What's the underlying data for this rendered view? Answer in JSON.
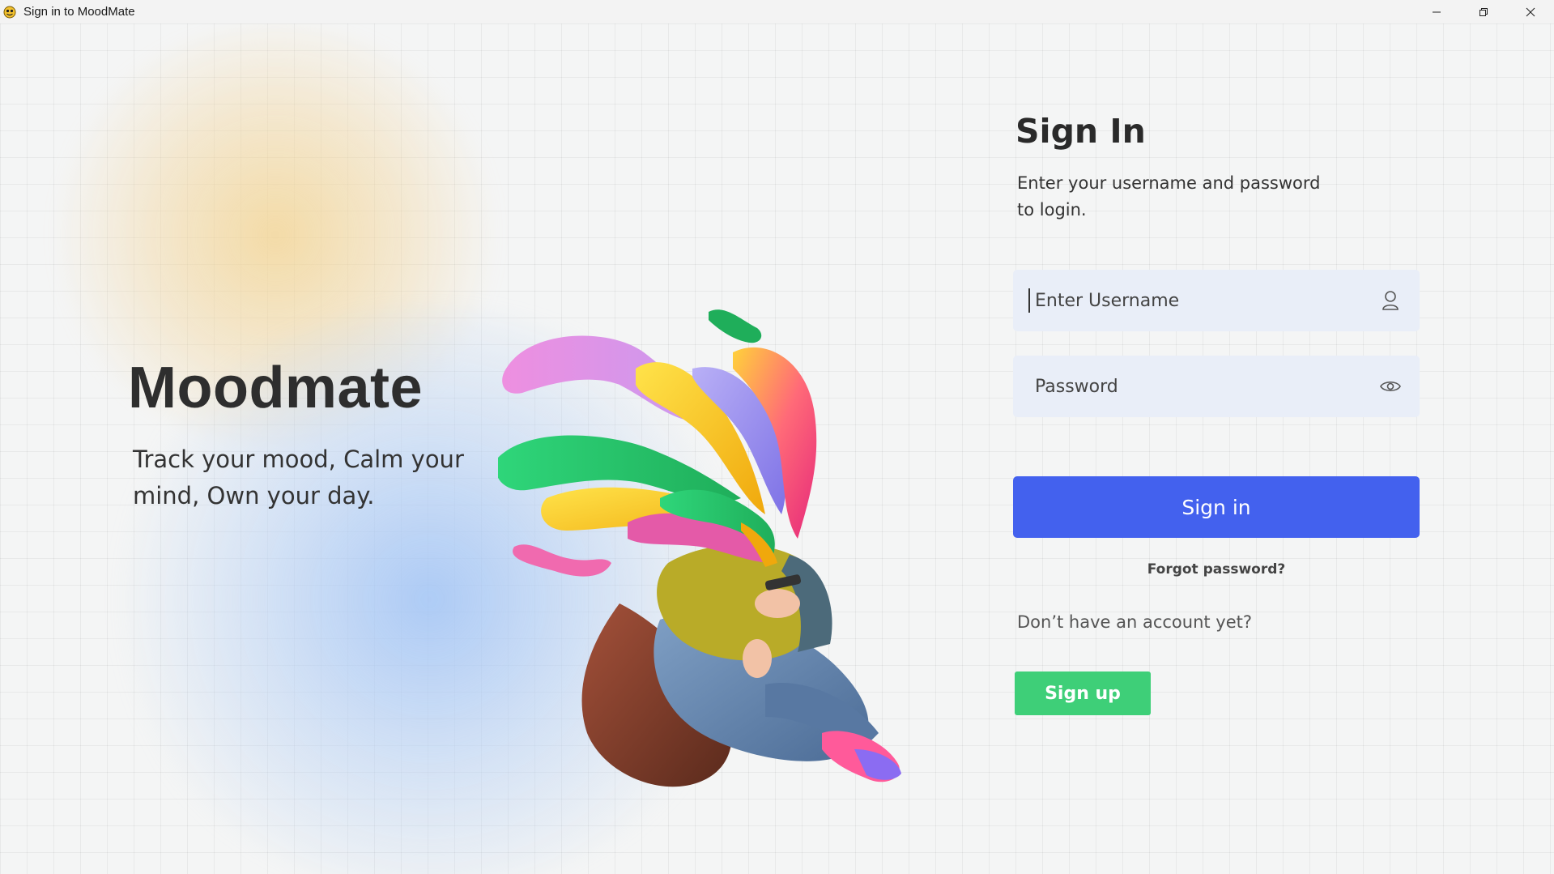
{
  "window": {
    "title": "Sign in to MoodMate",
    "app_icon": "moodmate-face-icon",
    "controls": [
      "minimize-icon",
      "restore-icon",
      "close-icon"
    ]
  },
  "brand": {
    "name": "Moodmate",
    "tagline": "Track your mood, Calm your mind, Own your day."
  },
  "illustration": {
    "icon": "person-with-colorful-swirls-illustration"
  },
  "signin": {
    "title": "Sign In",
    "subtitle": "Enter your username and password to login.",
    "username": {
      "placeholder": "Enter Username",
      "value": "",
      "icon": "user-icon"
    },
    "password": {
      "placeholder": "Password",
      "value": "",
      "icon": "eye-icon"
    },
    "submit_label": "Sign in",
    "forgot_label": "Forgot password?",
    "no_account_text": "Don’t have an account yet?",
    "signup_label": "Sign up"
  },
  "colors": {
    "primary": "#4361ee",
    "signup": "#3ecf78",
    "field_bg": "#e9eef8",
    "background": "#f4f5f5",
    "text_dark": "#2e2e2e"
  }
}
